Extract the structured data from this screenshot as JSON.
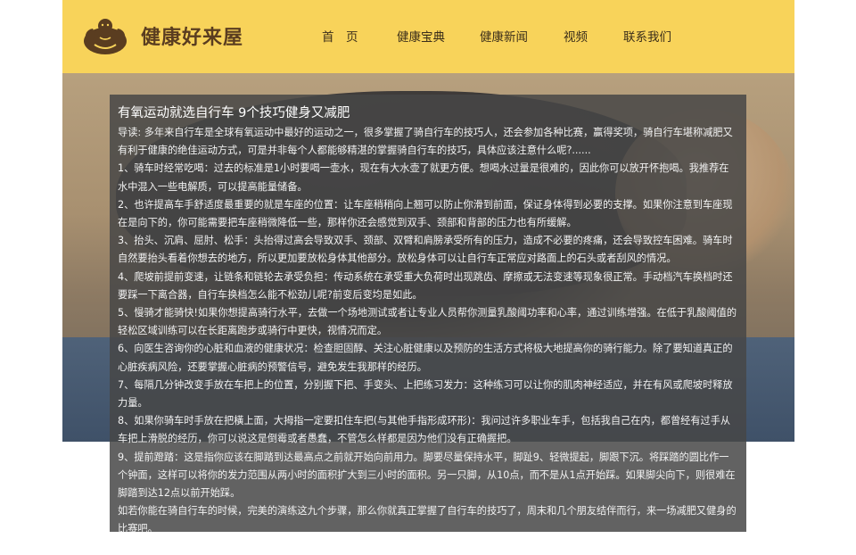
{
  "site": {
    "name": "健康好来屋",
    "logo_icon": "muscleman-icon"
  },
  "nav": {
    "items": [
      {
        "label": "首　页"
      },
      {
        "label": "健康宝典"
      },
      {
        "label": "健康新闻"
      },
      {
        "label": "视频"
      },
      {
        "label": "联系我们"
      }
    ]
  },
  "hero": {
    "image": "yoga-stretch-photo"
  },
  "article": {
    "title": "有氧运动就选自行车 9个技巧健身又减肥",
    "paragraphs": [
      "导读: 多年来自行车是全球有氧运动中最好的运动之一，很多掌握了骑自行车的技巧人，还会参加各种比赛，赢得奖项，骑自行车堪称减肥又有利于健康的绝佳运动方式，可是并非每个人都能够精湛的掌握骑自行车的技巧，具体应该注意什么呢?......",
      "1、骑车时经常吃喝：过去的标准是1小时要喝一壶水，现在有大水壶了就更方便。想喝水过量是很难的，因此你可以放开怀抱喝。我推荐在水中混入一些电解质，可以提高能量储备。",
      "2、也许提高车手舒适度最重要的就是车座的位置：让车座稍稍向上翘可以防止你滑到前面，保证身体得到必要的支撑。如果你注意到车座现在是向下的，你可能需要把车座稍微降低一些，那样你还会感觉到双手、颈部和背部的压力也有所缓解。",
      "3、抬头、沉肩、屈肘、松手：头抬得过高会导致双手、颈部、双臂和肩膀承受所有的压力，造成不必要的疼痛，还会导致控车困难。骑车时自然要抬头看着你想去的地方，所以更加要放松身体其他部分。放松身体可以让自行车正常应对路面上的石头或者刮风的情况。",
      "4、爬坡前提前变速，让链条和链轮去承受负担：传动系统在承受重大负荷时出现跳齿、摩擦或无法变速等现象很正常。手动档汽车换档时还要踩一下离合器，自行车换档怎么能不松劲儿呢?前变后变均是如此。",
      "5、慢骑才能骑快!如果你想提高骑行水平，去做一个场地测试或者让专业人员帮你测量乳酸阈功率和心率，通过训练增强。在低于乳酸阈值的轻松区域训练可以在长距离跑步或骑行中更快，视情况而定。",
      "6、向医生咨询你的心脏和血液的健康状况：检查胆固醇、关注心脏健康以及预防的生活方式将极大地提高你的骑行能力。除了要知道真正的心脏疾病风险，还要掌握心脏病的预警信号，避免发生我那样的经历。",
      "7、每隔几分钟改变手放在车把上的位置，分别握下把、手变头、上把练习发力：这种练习可以让你的肌肉神经适应，并在有风或爬坡时释放力量。",
      "8、如果你骑车时手放在把橫上面，大拇指一定要扣住车把(与其他手指形成环形)：我问过许多职业车手，包括我自己在内，都曾经有过手从车把上滑脱的经历，你可以说这是倒霉或者愚蠢，不管怎么样都是因为他们没有正确握把。",
      "9、提前蹬踏：这是指你应该在脚踏到达最高点之前就开始向前用力。脚要尽量保持水平，脚趾9、轻微提起，脚跟下沉。将踩踏的圆比作一个钟面，这样可以将你的发力范围从两小时的面积扩大到三小时的面积。另一只脚，从10点，而不是从1点开始踩。如果脚尖向下，则很难在脚踏到达12点以前开始踩。",
      "如若你能在骑自行车的时候，完美的演练这九个步骤，那么你就真正掌握了自行车的技巧了，周末和几个朋友结伴而行，来一场减肥又健身的比赛吧。"
    ]
  },
  "colors": {
    "header_bg": "#f8d35a",
    "logo_brown": "#5a3d20",
    "overlay": "#464646"
  }
}
